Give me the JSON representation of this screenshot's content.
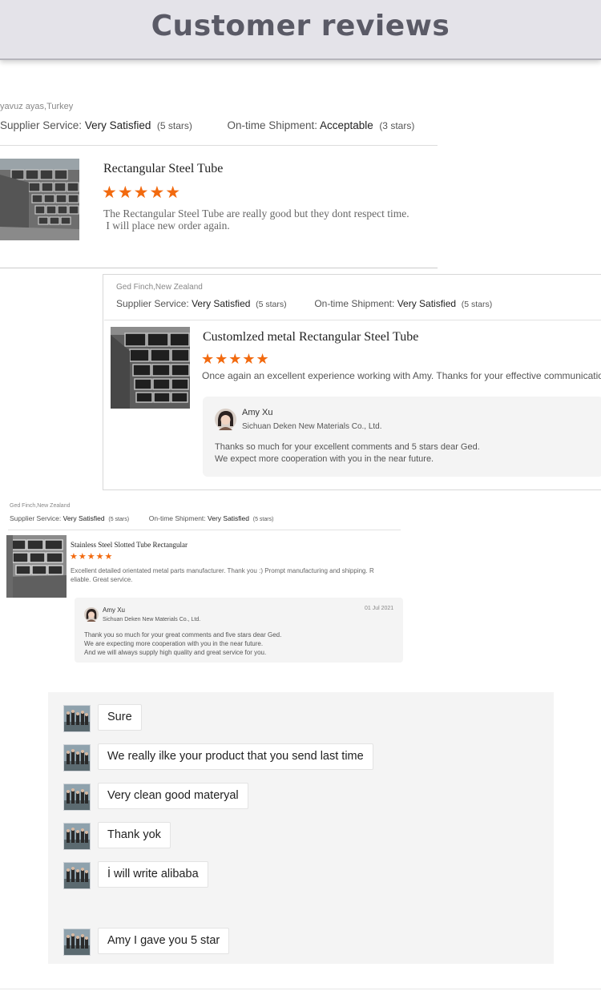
{
  "header": {
    "title": "Customer reviews"
  },
  "reviews": [
    {
      "reviewer": "yavuz ayas,Turkey",
      "supplier_service_label": "Supplier Service:",
      "supplier_service_value": "Very Satisfied",
      "supplier_service_stars": "(5 stars)",
      "shipment_label": "On-time Shipment:",
      "shipment_value": "Acceptable",
      "shipment_stars": "(3 stars)",
      "product_title": "Rectangular Steel Tube",
      "rating_stars": "★★★★★",
      "rating": 5,
      "comment_line1": "The Rectangular Steel Tube are really good but they dont respect time.",
      "comment_line2": " I will place new order again."
    },
    {
      "reviewer": "Ged Finch,New Zealand",
      "supplier_service_label": "Supplier Service:",
      "supplier_service_value": "Very Satisfied",
      "supplier_service_stars": "(5 stars)",
      "shipment_label": "On-time Shipment:",
      "shipment_value": "Very Satisfied",
      "shipment_stars": "(5 stars)",
      "product_title": "Customlzed metal Rectangular Steel Tube",
      "rating_stars": "★★★★★",
      "rating": 5,
      "comment": "Once again an excellent experience working with Amy. Thanks for your effective communication.",
      "reply": {
        "name": "Amy Xu",
        "company": "Sichuan Deken New Materials Co., Ltd.",
        "line1": "Thanks so much for your excellent comments and 5 stars dear Ged.",
        "line2": "We expect more cooperation with you in the near future."
      }
    },
    {
      "reviewer": "Ged Finch,New Zealand",
      "supplier_service_label": "Supplier Service:",
      "supplier_service_value": "Very Satisfied",
      "supplier_service_stars": "(5 stars)",
      "shipment_label": "On-time Shipment:",
      "shipment_value": "Very Satisfied",
      "shipment_stars": "(5 stars)",
      "product_title": "Stainless Steel Slotted Tube Rectangular",
      "rating_stars": "★★★★★",
      "rating": 5,
      "comment_line1": "Excellent detailed orientated metal parts manufacturer. Thank you :) Prompt manufacturing and shipping. R",
      "comment_line2": "eliable. Great service.",
      "reply": {
        "name": "Amy Xu",
        "company": "Sichuan Deken New Materials Co., Ltd.",
        "date": "01 Jul 2021",
        "line1": "Thank you so much for your great comments and five stars dear Ged.",
        "line2": "We are expecting more cooperation with you in the near future.",
        "line3": "And we will always supply high quality and great service for you."
      }
    }
  ],
  "chat": {
    "messages": [
      "Sure",
      "We really ilke your product that you send last time",
      "Very clean good materyal",
      "Thank yok",
      "İ will write alibaba",
      "Amy I gave you 5 star"
    ]
  },
  "colors": {
    "star": "#f26a0f",
    "banner_bg": "#e4e3e9",
    "banner_text": "#5a5a66",
    "chat_bg": "#f4f4f4"
  }
}
